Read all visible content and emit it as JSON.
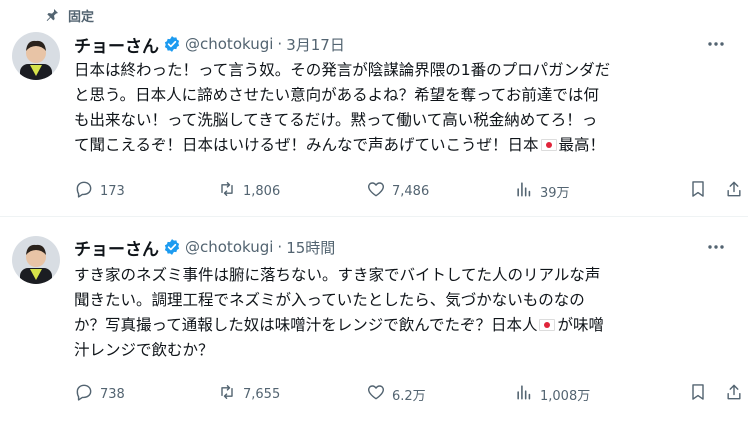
{
  "pinned": {
    "label": "固定"
  },
  "tweets": [
    {
      "display_name": "チョーさん",
      "handle": "@chotokugi",
      "separator": "·",
      "time": "3月17日",
      "lines": [
        "日本は終わった！って言う奴。その発言が陰謀論界隈の1番のプロパガンダだ",
        "と思う。日本人に諦めさせたい意向があるよね？希望を奪ってお前達では何",
        "も出来ない！って洗脳してきてるだけ。黙って働いて高い税金納めてろ！っ",
        "て聞こえるぞ！日本はいけるぜ！みんなで声あげていこうぜ！日本",
        "最高！"
      ],
      "stats": {
        "replies": "173",
        "reposts": "1,806",
        "likes": "7,486",
        "views": "39万"
      }
    },
    {
      "display_name": "チョーさん",
      "handle": "@chotokugi",
      "separator": "·",
      "time": "15時間",
      "lines": [
        "すき家のネズミ事件は腑に落ちない。すき家でバイトしてた人のリアルな声",
        "聞きたい。調理工程でネズミが入っていたとしたら、気づかないものなの",
        "か？写真撮って通報した奴は味噌汁をレンジで飲んでたぞ？日本人",
        "が味噌",
        "汁レンジで飲むか？"
      ],
      "stats": {
        "replies": "738",
        "reposts": "7,655",
        "likes": "6.2万",
        "views": "1,008万"
      }
    }
  ],
  "icons": {
    "pin": "pin-icon",
    "verified": "verified-badge-icon",
    "more": "more-options-icon",
    "reply": "reply-icon",
    "repost": "repost-icon",
    "like": "heart-icon",
    "views": "views-chart-icon",
    "bookmark": "bookmark-icon",
    "share": "share-icon",
    "flag": "japan-flag-emoji"
  },
  "colors": {
    "text": "#0f1419",
    "secondary": "#536471",
    "verified": "#1d9bf0",
    "divider": "#eff3f4"
  }
}
